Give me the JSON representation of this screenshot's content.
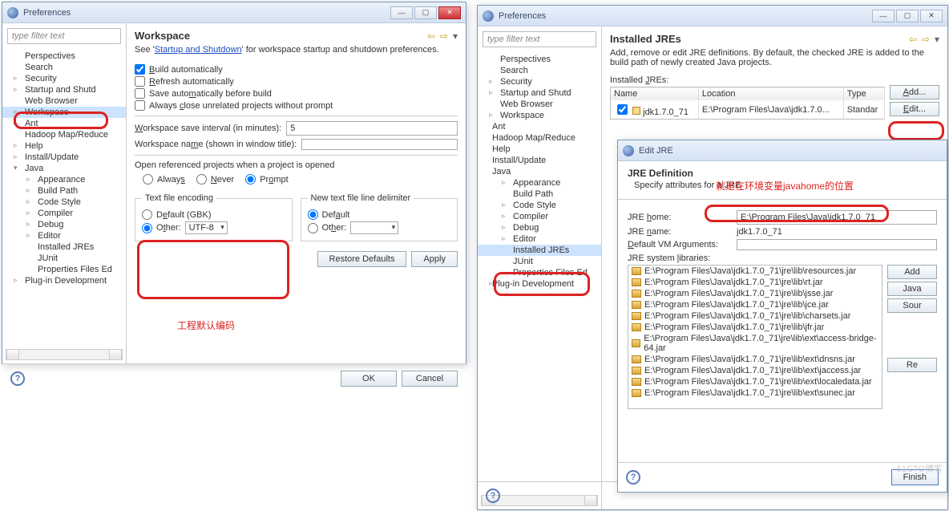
{
  "win1": {
    "title": "Preferences",
    "filter": "type filter text",
    "tree": [
      "Perspectives",
      "Search",
      "Security",
      "Startup and Shutd",
      "Web Browser",
      "Workspace",
      "Ant",
      "Hadoop Map/Reduce",
      "Help",
      "Install/Update",
      "Java",
      "Appearance",
      "Build Path",
      "Code Style",
      "Compiler",
      "Debug",
      "Editor",
      "Installed JREs",
      "JUnit",
      "Properties Files Ed",
      "Plug-in Development"
    ],
    "heading": "Workspace",
    "see": "See '",
    "seelink": "Startup and Shutdown",
    "see2": "' for workspace startup and shutdown preferences.",
    "chk1": "Build automatically",
    "chk2": "Refresh automatically",
    "chk3": "Save automatically before build",
    "chk4": "Always close unrelated projects without prompt",
    "saveint_lbl": "Workspace save interval (in minutes):",
    "saveint_val": "5",
    "wsname_lbl": "Workspace name (shown in window title):",
    "openref": "Open referenced projects when a project is opened",
    "always": "Always",
    "never": "Never",
    "prompt": "Prompt",
    "enc_legend": "Text file encoding",
    "enc_default": "Default (GBK)",
    "enc_other": "Other:",
    "enc_val": "UTF-8",
    "delim_legend": "New text file line delimiter",
    "delim_default": "Default",
    "delim_other": "Other:",
    "restore": "Restore Defaults",
    "apply": "Apply",
    "ok": "OK",
    "cancel": "Cancel",
    "anno": "工程默认编码"
  },
  "win2": {
    "title": "Preferences",
    "filter": "type filter text",
    "tree": [
      "Perspectives",
      "Search",
      "Security",
      "Startup and Shutd",
      "Web Browser",
      "Workspace",
      "Ant",
      "Hadoop Map/Reduce",
      "Help",
      "Install/Update",
      "Java",
      "Appearance",
      "Build Path",
      "Code Style",
      "Compiler",
      "Debug",
      "Editor",
      "Installed JREs",
      "JUnit",
      "Properties Files Ed",
      "Plug-in Development"
    ],
    "heading": "Installed JREs",
    "desc": "Add, remove or edit JRE definitions. By default, the checked JRE is added to the build path of newly created Java projects.",
    "tbl_lbl": "Installed JREs:",
    "th_name": "Name",
    "th_loc": "Location",
    "th_type": "Type",
    "row_name": "jdk1.7.0_71",
    "row_loc": "E:\\Program Files\\Java\\jdk1.7.0...",
    "row_type": "Standar",
    "add": "Add...",
    "edit": "Edit..."
  },
  "dlg": {
    "title": "Edit JRE",
    "heading": "JRE Definition",
    "sub": "Specify attributes for a JRE",
    "anno": "就是在环境变量javahome的位置",
    "home_lbl": "JRE home:",
    "home_val": "E:\\Program Files\\Java\\jdk1.7.0_71",
    "name_lbl": "JRE name:",
    "name_val": "jdk1.7.0_71",
    "defarg_lbl": "Default VM Arguments:",
    "lib_lbl": "JRE system libraries:",
    "libs": [
      "E:\\Program Files\\Java\\jdk1.7.0_71\\jre\\lib\\resources.jar",
      "E:\\Program Files\\Java\\jdk1.7.0_71\\jre\\lib\\rt.jar",
      "E:\\Program Files\\Java\\jdk1.7.0_71\\jre\\lib\\jsse.jar",
      "E:\\Program Files\\Java\\jdk1.7.0_71\\jre\\lib\\jce.jar",
      "E:\\Program Files\\Java\\jdk1.7.0_71\\jre\\lib\\charsets.jar",
      "E:\\Program Files\\Java\\jdk1.7.0_71\\jre\\lib\\jfr.jar",
      "E:\\Program Files\\Java\\jdk1.7.0_71\\jre\\lib\\ext\\access-bridge-64.jar",
      "E:\\Program Files\\Java\\jdk1.7.0_71\\jre\\lib\\ext\\dnsns.jar",
      "E:\\Program Files\\Java\\jdk1.7.0_71\\jre\\lib\\ext\\jaccess.jar",
      "E:\\Program Files\\Java\\jdk1.7.0_71\\jre\\lib\\ext\\localedata.jar",
      "E:\\Program Files\\Java\\jdk1.7.0_71\\jre\\lib\\ext\\sunec.jar"
    ],
    "btn_add": "Add",
    "btn_java": "Java",
    "btn_sour": "Sour",
    "btn_re": "Re",
    "finish": "Finish"
  },
  "watermark": "51CTO博客"
}
